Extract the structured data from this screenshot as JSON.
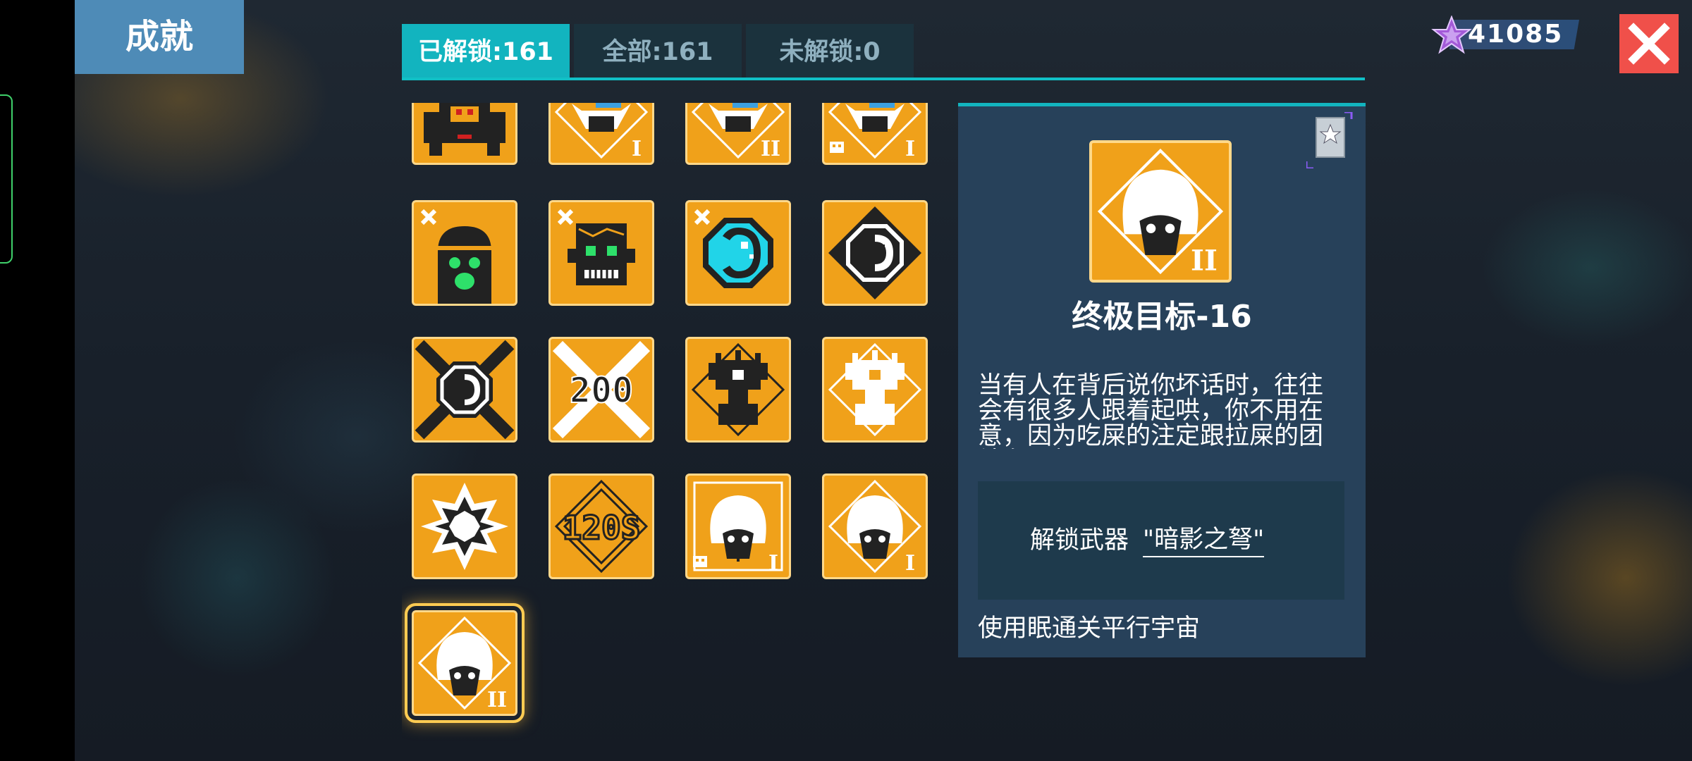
{
  "header": {
    "title": "成就"
  },
  "tabs": [
    {
      "label": "已解锁:161",
      "active": true
    },
    {
      "label": "全部:161",
      "active": false
    },
    {
      "label": "未解锁:0",
      "active": false
    }
  ],
  "currency": {
    "value": "41085",
    "icon": "purple-star-icon"
  },
  "close": {
    "icon": "close-icon",
    "color": "#f0504a"
  },
  "badges": {
    "row0": [
      {
        "icon": "mech-robot-icon"
      },
      {
        "icon": "ghost-cat-icon",
        "numeral": "I"
      },
      {
        "icon": "ghost-cat-icon",
        "numeral": "II"
      },
      {
        "icon": "ghost-cat-icon",
        "numeral": "I",
        "skull": true
      }
    ],
    "row1": [
      {
        "icon": "hooded-zombie-icon"
      },
      {
        "icon": "frankenstein-icon"
      },
      {
        "icon": "cyan-skull-icon"
      },
      {
        "icon": "octagon-skull-icon"
      }
    ],
    "row2": [
      {
        "icon": "crossed-skull-icon"
      },
      {
        "icon": "kills-200-icon",
        "text": "200"
      },
      {
        "icon": "trophy-dark-icon"
      },
      {
        "icon": "trophy-white-icon"
      }
    ],
    "row3": [
      {
        "icon": "star-gear-icon"
      },
      {
        "icon": "time-120s-icon",
        "text": "120S"
      },
      {
        "icon": "white-hair-girl-icon",
        "numeral": "I",
        "skull": true
      },
      {
        "icon": "white-hair-girl-icon",
        "numeral": "I"
      }
    ],
    "row4": [
      {
        "icon": "white-hair-girl-icon",
        "numeral": "II",
        "selected": true
      }
    ]
  },
  "detail": {
    "title": "终极目标-16",
    "numeral": "II",
    "description": "当有人在背后说你坏话时，往往会有很多人跟着起哄，你不用在意，因为吃屎的注定跟拉屎的团结在一起",
    "reward_label": "解锁武器",
    "reward_weapon": "\"暗影之弩\"",
    "condition": "使用眠通关平行宇宙"
  },
  "colors": {
    "badge_bg": "#f0a11a",
    "tab_active": "#12b4bf",
    "panel": "#27415a"
  }
}
